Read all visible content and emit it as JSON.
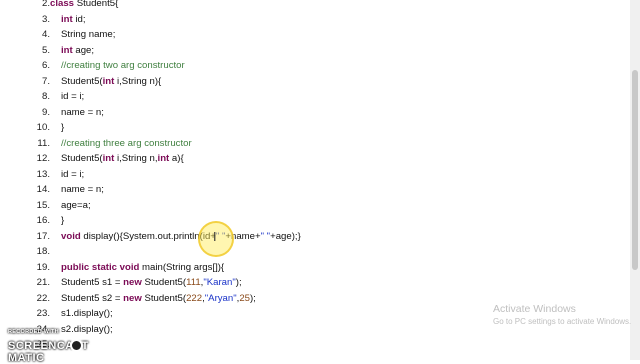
{
  "lines": [
    {
      "num": "2.",
      "segs": [
        {
          "t": "class ",
          "c": "kw"
        },
        {
          "t": "Student5{",
          "c": ""
        }
      ]
    },
    {
      "num": "3.",
      "segs": [
        {
          "t": "int ",
          "c": "kw"
        },
        {
          "t": "id;",
          "c": ""
        }
      ]
    },
    {
      "num": "4.",
      "segs": [
        {
          "t": "String name;",
          "c": ""
        }
      ]
    },
    {
      "num": "5.",
      "segs": [
        {
          "t": "int ",
          "c": "kw"
        },
        {
          "t": "age;",
          "c": ""
        }
      ]
    },
    {
      "num": "6.",
      "segs": [
        {
          "t": "//creating two arg constructor",
          "c": "cm"
        }
      ]
    },
    {
      "num": "7.",
      "segs": [
        {
          "t": "Student5(",
          "c": ""
        },
        {
          "t": "int ",
          "c": "kw"
        },
        {
          "t": "i,String n){",
          "c": ""
        }
      ]
    },
    {
      "num": "8.",
      "segs": [
        {
          "t": "id = i;",
          "c": ""
        }
      ]
    },
    {
      "num": "9.",
      "segs": [
        {
          "t": "name = n;",
          "c": ""
        }
      ]
    },
    {
      "num": "10.",
      "segs": [
        {
          "t": "}",
          "c": ""
        }
      ]
    },
    {
      "num": "11.",
      "segs": [
        {
          "t": "//creating three arg constructor",
          "c": "cm"
        }
      ]
    },
    {
      "num": "12.",
      "segs": [
        {
          "t": "Student5(",
          "c": ""
        },
        {
          "t": "int ",
          "c": "kw"
        },
        {
          "t": "i,String n,",
          "c": ""
        },
        {
          "t": "int ",
          "c": "kw"
        },
        {
          "t": "a){",
          "c": ""
        }
      ]
    },
    {
      "num": "13.",
      "segs": [
        {
          "t": "id = i;",
          "c": ""
        }
      ]
    },
    {
      "num": "14.",
      "segs": [
        {
          "t": "name = n;",
          "c": ""
        }
      ]
    },
    {
      "num": "15.",
      "segs": [
        {
          "t": "age=a;",
          "c": ""
        }
      ]
    },
    {
      "num": "16.",
      "segs": [
        {
          "t": "}",
          "c": ""
        }
      ]
    },
    {
      "num": "17.",
      "segs": [
        {
          "t": "void ",
          "c": "kw"
        },
        {
          "t": "display(){System.out.println(id+",
          "c": ""
        },
        {
          "t": "\" \"",
          "c": "st"
        },
        {
          "t": "+name+",
          "c": ""
        },
        {
          "t": "\" \"",
          "c": "st"
        },
        {
          "t": "+age);}",
          "c": ""
        }
      ]
    },
    {
      "num": "18.",
      "segs": []
    },
    {
      "num": "19.",
      "segs": [
        {
          "t": "public static void ",
          "c": "kw"
        },
        {
          "t": "main(String args[]){",
          "c": ""
        }
      ]
    },
    {
      "num": "21.",
      "segs": [
        {
          "t": "Student5 s1 = ",
          "c": ""
        },
        {
          "t": "new ",
          "c": "kw"
        },
        {
          "t": "Student5(",
          "c": ""
        },
        {
          "t": "111",
          "c": "nm"
        },
        {
          "t": ",",
          "c": ""
        },
        {
          "t": "\"Karan\"",
          "c": "st"
        },
        {
          "t": ");",
          "c": ""
        }
      ]
    },
    {
      "num": "22.",
      "segs": [
        {
          "t": "Student5 s2 = ",
          "c": ""
        },
        {
          "t": "new ",
          "c": "kw"
        },
        {
          "t": "Student5(",
          "c": ""
        },
        {
          "t": "222",
          "c": "nm"
        },
        {
          "t": ",",
          "c": ""
        },
        {
          "t": "\"Aryan\"",
          "c": "st"
        },
        {
          "t": ",",
          "c": ""
        },
        {
          "t": "25",
          "c": "nm"
        },
        {
          "t": ");",
          "c": ""
        }
      ]
    },
    {
      "num": "23.",
      "segs": [
        {
          "t": "s1.display();",
          "c": ""
        }
      ]
    },
    {
      "num": "24.",
      "segs": [
        {
          "t": "s2.display();",
          "c": ""
        }
      ]
    },
    {
      "num": "25.",
      "segs": []
    }
  ],
  "activate_windows": {
    "title": "Activate Windows",
    "subtitle": "Go to PC settings to activate Windows."
  },
  "watermark": {
    "top": "RECORDED WITH",
    "brand": "SCREENCAST  MATIC"
  },
  "colors": {
    "keyword": "#7b0a55",
    "comment": "#3f7f3f",
    "string": "#1a33c8",
    "number": "#8a4a1a",
    "cursor_highlight": "#ffeb50"
  },
  "icons": {
    "cursor": "ibeam-cursor-icon",
    "watermark_logo": "screencast-logo-icon"
  }
}
